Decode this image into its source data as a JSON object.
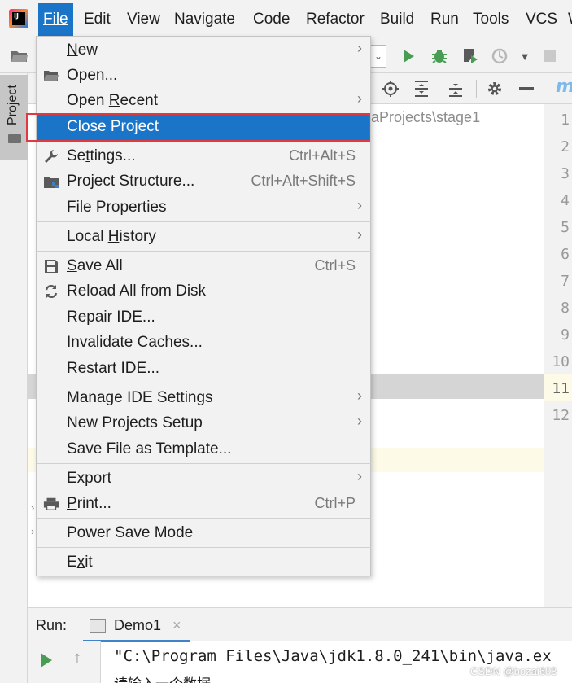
{
  "menubar": {
    "items": [
      {
        "label": "File"
      },
      {
        "label": "Edit"
      },
      {
        "label": "View"
      },
      {
        "label": "Navigate"
      },
      {
        "label": "Code"
      },
      {
        "label": "Refactor"
      },
      {
        "label": "Build"
      },
      {
        "label": "Run"
      },
      {
        "label": "Tools"
      },
      {
        "label": "VCS"
      },
      {
        "label": "W"
      }
    ]
  },
  "sidebar": {
    "project_tab": "Project"
  },
  "project_panel": {
    "path_fragment": "aProjects\\stage1"
  },
  "editor": {
    "tab_fragment": "m",
    "line_numbers": [
      "1",
      "2",
      "3",
      "4",
      "5",
      "6",
      "7",
      "8",
      "9",
      "10",
      "11",
      "12"
    ]
  },
  "file_menu": {
    "items": [
      {
        "label": "New",
        "submenu": true
      },
      {
        "label": "Open...",
        "icon": "folder-open-icon"
      },
      {
        "label": "Open Recent",
        "submenu": true
      },
      {
        "label": "Close Project",
        "selected": true
      },
      {
        "label": "Settings...",
        "shortcut": "Ctrl+Alt+S",
        "icon": "wrench-icon"
      },
      {
        "label": "Project Structure...",
        "shortcut": "Ctrl+Alt+Shift+S",
        "icon": "project-structure-icon"
      },
      {
        "label": "File Properties",
        "submenu": true
      },
      {
        "label": "Local History",
        "submenu": true
      },
      {
        "label": "Save All",
        "shortcut": "Ctrl+S",
        "icon": "floppy-disk-icon"
      },
      {
        "label": "Reload All from Disk",
        "icon": "reload-icon"
      },
      {
        "label": "Repair IDE..."
      },
      {
        "label": "Invalidate Caches..."
      },
      {
        "label": "Restart IDE..."
      },
      {
        "label": "Manage IDE Settings",
        "submenu": true
      },
      {
        "label": "New Projects Setup",
        "submenu": true
      },
      {
        "label": "Save File as Template..."
      },
      {
        "label": "Export",
        "submenu": true
      },
      {
        "label": "Print...",
        "shortcut": "Ctrl+P",
        "icon": "printer-icon"
      },
      {
        "label": "Power Save Mode"
      },
      {
        "label": "Exit"
      }
    ]
  },
  "run_panel": {
    "label": "Run:",
    "tab_label": "Demo1",
    "close_glyph": "×",
    "console_line1": "\"C:\\Program Files\\Java\\jdk1.8.0_241\\bin\\java.ex",
    "console_line2": "请输入一个数据"
  },
  "watermark": "CSDN @bozai603",
  "colors": {
    "menu_selected": "#1a75c9",
    "highlight_border": "#e0393e",
    "run_green": "#499c54"
  }
}
